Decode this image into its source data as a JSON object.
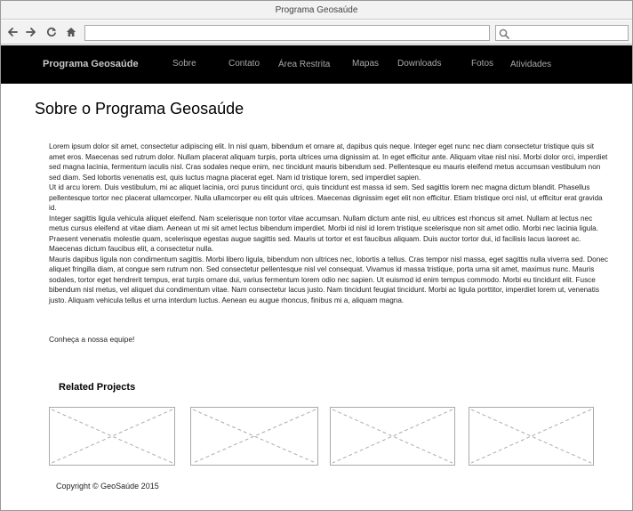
{
  "window": {
    "title": "Programa Geosaúde"
  },
  "toolbar": {
    "back_icon": "back-arrow-icon",
    "forward_icon": "forward-arrow-icon",
    "reload_icon": "reload-icon",
    "home_icon": "home-icon",
    "url_value": "",
    "search_value": "",
    "search_icon": "magnifier-icon"
  },
  "site_nav": {
    "brand": "Programa Geosaúde",
    "links": [
      "Sobre",
      "Contato",
      "Área Restrita",
      "Mapas",
      "Downloads",
      "Fotos",
      "Atividades"
    ]
  },
  "main": {
    "title": "Sobre o Programa Geosaúde",
    "paragraphs": [
      "Lorem ipsum dolor sit amet, consectetur adipiscing elit. In nisl quam, bibendum et ornare at, dapibus quis neque. Integer eget nunc nec diam consectetur tristique quis sit amet eros. Maecenas sed rutrum dolor. Nullam placerat aliquam turpis, porta ultrices urna dignissim at. In eget efficitur ante. Aliquam vitae nisl nisi. Morbi dolor orci, imperdiet sed magna lacinia, fermentum iaculis nisl. Cras sodales neque enim, nec tincidunt mauris bibendum sed. Pellentesque eu mauris eleifend metus accumsan vestibulum non sed diam. Sed lobortis venenatis est, quis luctus magna placerat eget. Nam id tristique lorem, sed imperdiet sapien.",
      "Ut id arcu lorem. Duis vestibulum, mi ac aliquet lacinia, orci purus tincidunt orci, quis tincidunt est massa id sem. Sed sagittis lorem nec magna dictum blandit. Phasellus pellentesque tortor nec placerat ullamcorper. Nulla ullamcorper eu elit quis ultrices. Maecenas dignissim eget elit non efficitur. Etiam tristique orci nisl, ut efficitur erat gravida id.",
      "Integer sagittis ligula vehicula aliquet eleifend. Nam scelerisque non tortor vitae accumsan. Nullam dictum ante nisl, eu ultrices est rhoncus sit amet. Nullam at lectus nec metus cursus eleifend at vitae diam. Aenean ut mi sit amet lectus bibendum imperdiet. Morbi id nisl id lorem tristique scelerisque non sit amet odio. Morbi nec lacinia ligula. Praesent venenatis molestie quam, scelerisque egestas augue sagittis sed. Mauris ut tortor et est faucibus aliquam. Duis auctor tortor dui, id facilisis lacus laoreet ac. Maecenas dictum faucibus elit, a consectetur nulla.",
      "Mauris dapibus ligula non condimentum sagittis. Morbi libero ligula, bibendum non ultrices nec, lobortis a tellus. Cras tempor nisl massa, eget sagittis nulla viverra sed. Donec aliquet fringilla diam, at congue sem rutrum non. Sed consectetur pellentesque nisl vel consequat. Vivamus id massa tristique, porta urna sit amet, maximus nunc. Mauris sodales, tortor eget hendrerit tempus, erat turpis ornare dui, varius fermentum lorem odio nec sapien. Ut euismod id enim tempus commodo. Morbi eu tincidunt elit. Fusce bibendum nisl metus, vel aliquet dui condimentum vitae. Nam consectetur lacus justo. Nam tincidunt feugiat tincidunt. Morbi ac ligula porttitor, imperdiet lorem ut, venenatis justo. Aliquam vehicula tellus et urna interdum luctus. Aenean eu augue rhoncus, finibus mi a, aliquam magna."
    ],
    "team_line": "Conheça a nossa equipe!"
  },
  "related": {
    "heading": "Related Projects",
    "items": [
      {
        "name": "related-project-1"
      },
      {
        "name": "related-project-2"
      },
      {
        "name": "related-project-3"
      },
      {
        "name": "related-project-4"
      }
    ]
  },
  "footer": {
    "copyright": "Copyright © GeoSaúde 2015"
  }
}
